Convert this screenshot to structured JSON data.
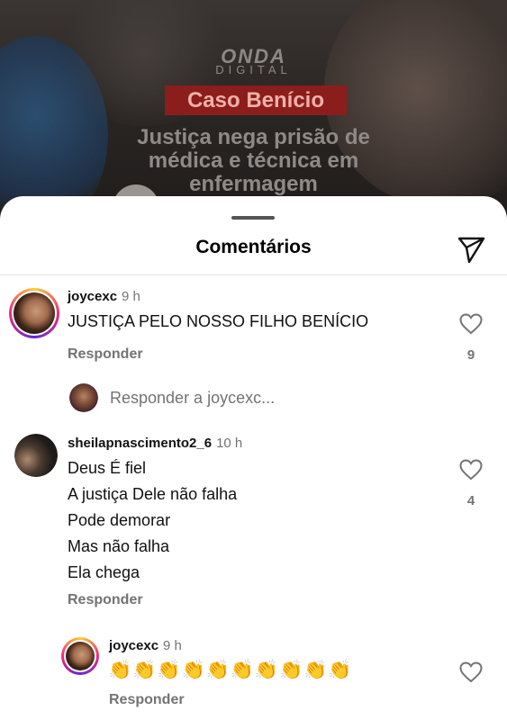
{
  "post": {
    "brand": "ONDA",
    "brand_sub": "DIGITAL",
    "tag": "Caso Benício",
    "headline_line1": "Justiça nega prisão de",
    "headline_line2": "médica e técnica em",
    "headline_line3": "enfermagem"
  },
  "sheet": {
    "title": "Comentários"
  },
  "comments": [
    {
      "username": "joycexc",
      "time": "9 h",
      "text": "JUSTIÇA PELO NOSSO FILHO BENÍCIO",
      "reply_label": "Responder",
      "likes": "9"
    },
    {
      "username": "sheilapnascimento2_6",
      "time": "10 h",
      "lines": [
        "Deus É fiel",
        "A justiça Dele não falha",
        "Pode demorar",
        "Mas não falha",
        "Ela chega"
      ],
      "reply_label": "Responder",
      "likes": "4"
    },
    {
      "username": "joycexc",
      "time": "9 h",
      "text": "👏👏👏👏👏👏👏👏👏👏",
      "reply_label": "Responder"
    }
  ],
  "reply_prompt": "Responder a joycexc...",
  "icons": {
    "send": "send-icon",
    "like": "heart-icon"
  },
  "colors": {
    "secondary_text": "#737373",
    "tag_bg": "#8c1d1d"
  }
}
